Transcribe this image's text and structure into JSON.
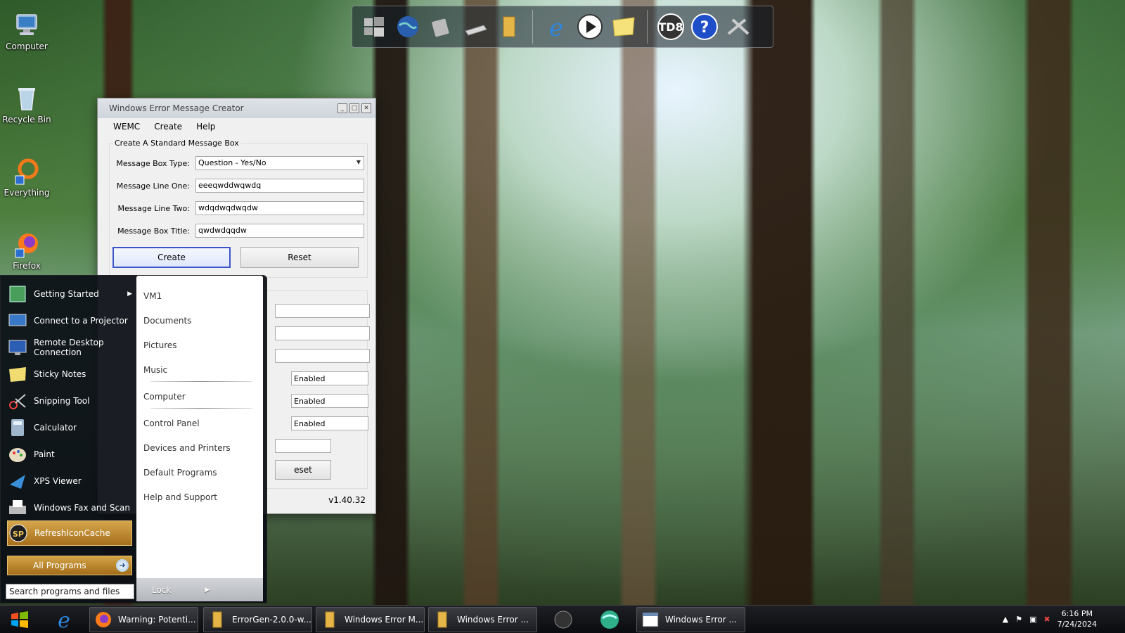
{
  "desktop_icons": [
    {
      "name": "Computer"
    },
    {
      "name": "Recycle Bin"
    },
    {
      "name": "Everything"
    },
    {
      "name": "Firefox"
    }
  ],
  "dock": {
    "td_label": "TD8"
  },
  "window": {
    "title": "Windows Error Message Creator",
    "menu": [
      "WEMC",
      "Create",
      "Help"
    ],
    "group_title": "Create A Standard Message Box",
    "fields": {
      "type_label": "Message Box Type:",
      "type_value": "Question - Yes/No",
      "line1_label": "Message Line One:",
      "line1_value": "eeeqwddwqwdq",
      "line2_label": "Message Line Two:",
      "line2_value": "wdqdwqdwqdw",
      "title_label": "Message Box Title:",
      "title_value": "qwdwdqqdw"
    },
    "create_label": "Create",
    "reset_label": "Reset",
    "partial": {
      "enabled1": "Enabled",
      "enabled2": "Enabled",
      "enabled3": "Enabled",
      "reset_fragment": "eset"
    },
    "version": "v1.40.32"
  },
  "start_menu": {
    "programs": [
      {
        "label": "Getting Started"
      },
      {
        "label": "Connect to a Projector"
      },
      {
        "label": "Remote Desktop Connection"
      },
      {
        "label": "Sticky Notes"
      },
      {
        "label": "Snipping Tool"
      },
      {
        "label": "Calculator"
      },
      {
        "label": "Paint"
      },
      {
        "label": "XPS Viewer"
      },
      {
        "label": "Windows Fax and Scan"
      },
      {
        "label": "RefreshIconCache"
      }
    ],
    "all_programs": "All Programs",
    "search_placeholder": "Search programs and files",
    "places": [
      "VM1",
      "Documents",
      "Pictures",
      "Music",
      "Computer",
      "Control Panel",
      "Devices and Printers",
      "Default Programs",
      "Help and Support"
    ],
    "lock_label": "Lock"
  },
  "taskbar": {
    "tasks": [
      {
        "label": "Warning: Potenti..."
      },
      {
        "label": "ErrorGen-2.0.0-w..."
      },
      {
        "label": "Windows Error M..."
      },
      {
        "label": "Windows Error ..."
      },
      {
        "label": "Windows Error ..."
      }
    ],
    "time": "6:16 PM",
    "date": "7/24/2024"
  },
  "colors": {
    "accent_button": "#3a55c9",
    "start_orange": "#c8923a",
    "taskbar": "#15161a"
  }
}
